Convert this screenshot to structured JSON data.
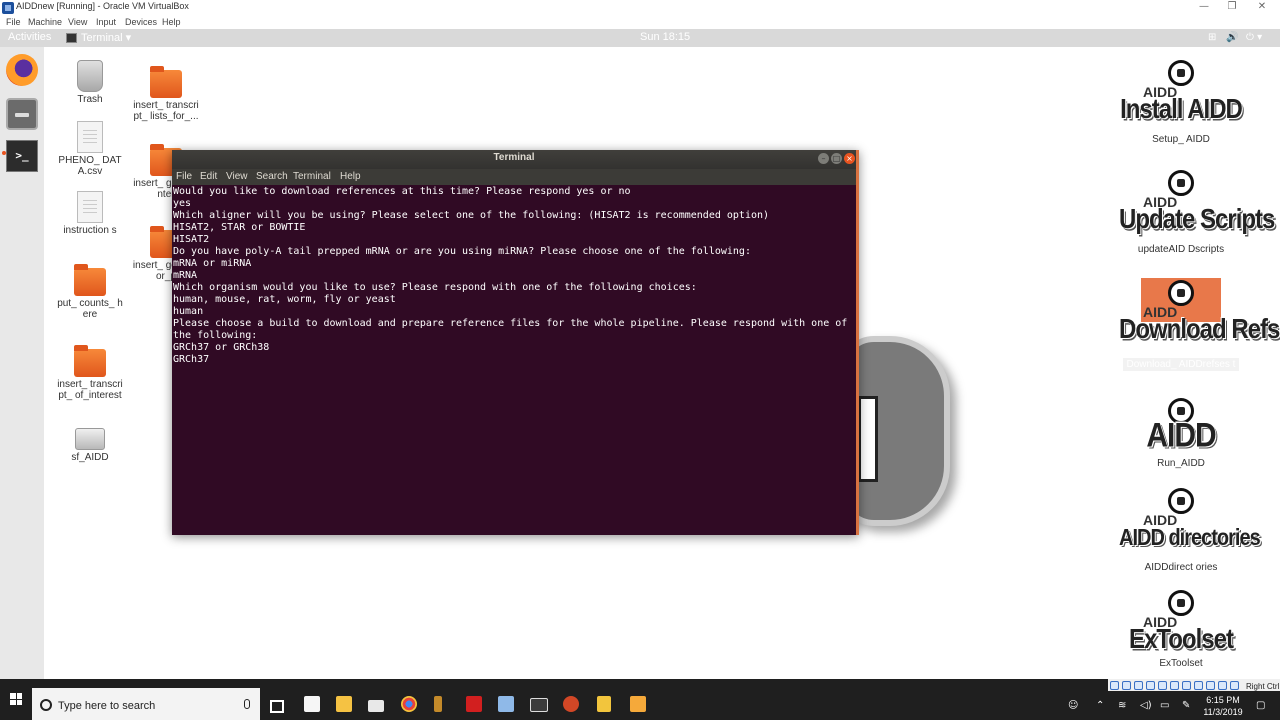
{
  "host_window": {
    "title": "AIDDnew [Running] - Oracle VM VirtualBox",
    "menu": [
      "File",
      "Machine",
      "View",
      "Input",
      "Devices",
      "Help"
    ],
    "controls": {
      "minimize": "—",
      "restore": "❐",
      "close": "✕"
    }
  },
  "gnome_bar": {
    "activities": "Activities",
    "app_menu": "Terminal ▾",
    "clock": "Sun 18:15",
    "tray": {
      "network": "⊞",
      "volume": "🔊",
      "power": "⏻ ▾"
    }
  },
  "desktop_icons": [
    {
      "label": "Trash",
      "kind": "trash-icon"
    },
    {
      "label": "insert_ transcript_ lists_for_...",
      "kind": "folder-icon"
    },
    {
      "label": "PHENO_ DATA.csv",
      "kind": "file-icon"
    },
    {
      "label": "insert_ gene_ inter",
      "kind": "folder-icon"
    },
    {
      "label": "instruction s",
      "kind": "file-icon"
    },
    {
      "label": "insert_ gene_ for_p",
      "kind": "folder-icon"
    },
    {
      "label": "put_ counts_ here",
      "kind": "folder-icon"
    },
    {
      "label": "insert_ transcript_ of_interest",
      "kind": "folder-icon"
    },
    {
      "label": "sf_AIDD",
      "kind": "drive-icon"
    }
  ],
  "launchers": [
    {
      "logo_text": "Install AIDD",
      "label": "Setup_ AIDD"
    },
    {
      "logo_text": "Update Scripts",
      "label": "updateAID Dscripts"
    },
    {
      "logo_text": "Download Refset",
      "label": "Download_ AIDDrefses t"
    },
    {
      "logo_text": "",
      "label": "Run_AIDD"
    },
    {
      "logo_text": "AIDD directories",
      "label": "AIDDdirect ories"
    },
    {
      "logo_text": "ExToolset",
      "label": "ExToolset"
    }
  ],
  "logo_aidd": "AIDD",
  "terminal": {
    "title": "Terminal",
    "menu": [
      "File",
      "Edit",
      "View",
      "Search",
      "Terminal",
      "Help"
    ],
    "lines": [
      "Would you like to download references at this time? Please respond yes or no",
      "yes",
      "Which aligner will you be using? Please select one of the following: (HISAT2 is recommended option)",
      "HISAT2, STAR or BOWTIE",
      "HISAT2",
      "Do you have poly-A tail prepped mRNA or are you using miRNA? Please choose one of the following:",
      "mRNA or miRNA",
      "mRNA",
      "Which organism would you like to use? Please respond with one of the following choices:",
      "human, mouse, rat, worm, fly or yeast",
      "human",
      "Please choose a build to download and prepare reference files for the whole pipeline. Please respond with one of the following:",
      "GRCh37 or GRCh38",
      "GRCh37"
    ]
  },
  "taskbar": {
    "search_placeholder": "Type here to search",
    "clock_time": "6:15 PM",
    "clock_date": "11/3/2019",
    "right_ctrl": "Right Ctrl"
  }
}
